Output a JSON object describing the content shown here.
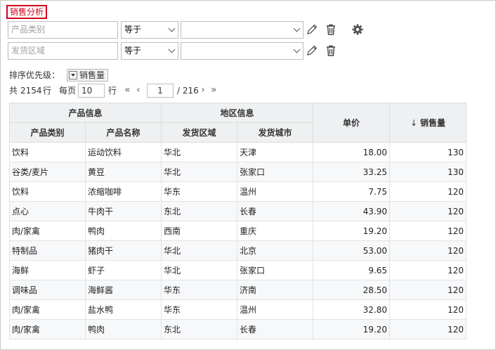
{
  "title": "销售分析",
  "filters": [
    {
      "field_placeholder": "产品类别",
      "operator": "等于",
      "value": ""
    },
    {
      "field_placeholder": "发货区域",
      "operator": "等于",
      "value": ""
    }
  ],
  "sort": {
    "label": "排序优先级：",
    "chip": "销售量"
  },
  "pager": {
    "total_prefix": "共",
    "total": "2154",
    "total_suffix": "行",
    "per_page_label": "每页",
    "per_page": "10",
    "per_page_suffix": "行",
    "current_page": "1",
    "total_pages": "/ 216"
  },
  "table": {
    "group_headers": [
      "产品信息",
      "地区信息"
    ],
    "sub_headers": [
      "产品类别",
      "产品名称",
      "发货区域",
      "发货城市"
    ],
    "price_header": "单价",
    "sales_header": "销售量",
    "sort_arrow": "↓",
    "rows": [
      [
        "饮料",
        "运动饮料",
        "华北",
        "天津",
        "18.00",
        "130"
      ],
      [
        "谷类/麦片",
        "黄豆",
        "华北",
        "张家口",
        "33.25",
        "130"
      ],
      [
        "饮料",
        "浓缩咖啡",
        "华东",
        "温州",
        "7.75",
        "120"
      ],
      [
        "点心",
        "牛肉干",
        "东北",
        "长春",
        "43.90",
        "120"
      ],
      [
        "肉/家禽",
        "鸭肉",
        "西南",
        "重庆",
        "19.20",
        "120"
      ],
      [
        "特制品",
        "猪肉干",
        "华北",
        "北京",
        "53.00",
        "120"
      ],
      [
        "海鲜",
        "虾子",
        "华北",
        "张家口",
        "9.65",
        "120"
      ],
      [
        "调味品",
        "海鲜酱",
        "华东",
        "济南",
        "28.50",
        "120"
      ],
      [
        "肉/家禽",
        "盐水鸭",
        "华东",
        "温州",
        "32.80",
        "120"
      ],
      [
        "肉/家禽",
        "鸭肉",
        "东北",
        "长春",
        "19.20",
        "120"
      ]
    ]
  }
}
